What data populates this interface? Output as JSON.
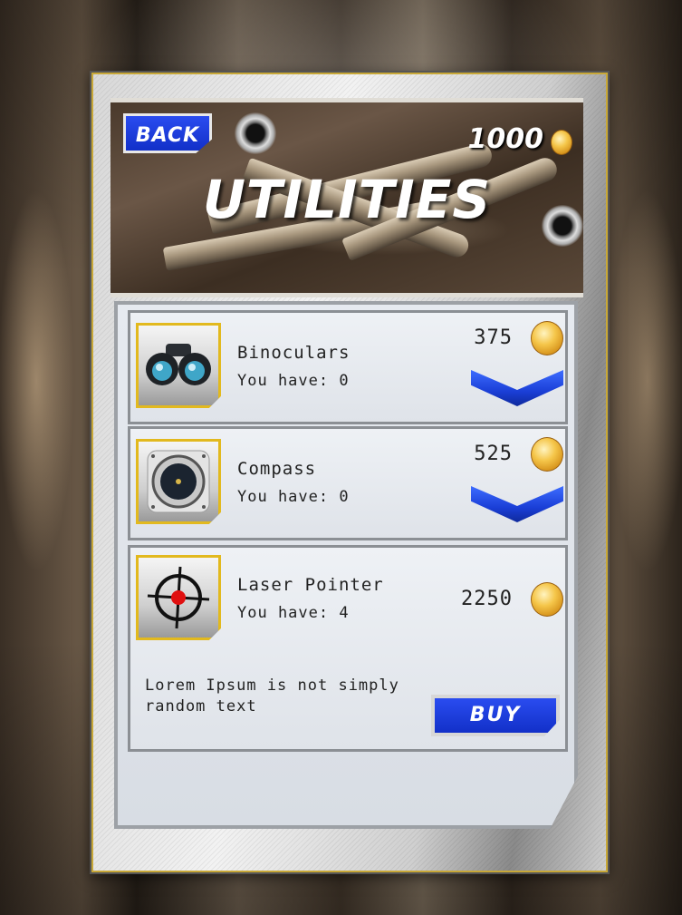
{
  "screen": {
    "title": "UTILITIES",
    "back_label": "BACK",
    "coins_total": "1000"
  },
  "items": [
    {
      "name": "Binoculars",
      "have": "You have: 0",
      "price": "375",
      "icon": "binoculars-icon",
      "action": "expand"
    },
    {
      "name": "Compass",
      "have": "You have: 0",
      "price": "525",
      "icon": "compass-icon",
      "action": "expand"
    },
    {
      "name": "Laser Pointer",
      "have": "You have: 4",
      "price": "2250",
      "icon": "crosshair-icon",
      "action": "buy",
      "description": "Lorem Ipsum is not simply random text",
      "buy_label": "BUY"
    }
  ],
  "colors": {
    "button_blue": "#1a3ed6",
    "thumb_border": "#e2b91e",
    "coin_gold": "#f5c64a"
  }
}
